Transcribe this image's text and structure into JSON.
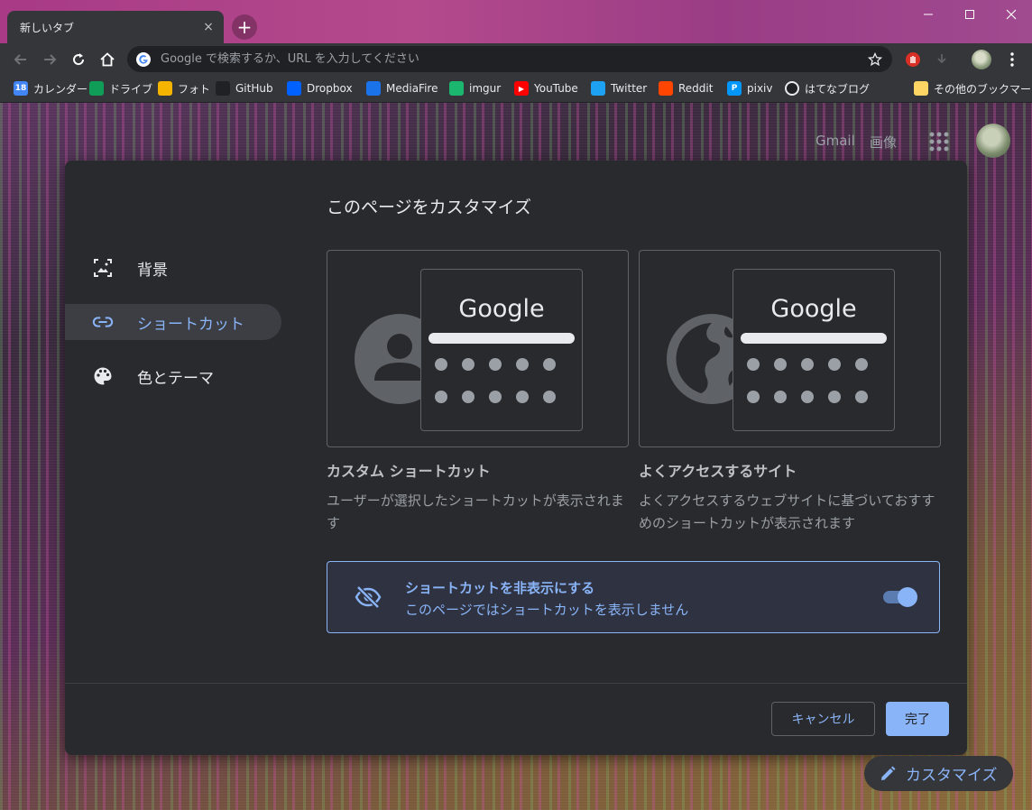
{
  "window": {
    "tab_title": "新しいタブ",
    "tab_close": "×",
    "new_tab": "+"
  },
  "toolbar": {
    "omnibox_placeholder": "Google で検索するか、URL を入力してください"
  },
  "bookmarks": [
    {
      "label": "カレンダー",
      "icon": "calendar-icon",
      "color": "#4285f4",
      "glyph": "18"
    },
    {
      "label": "ドライブ",
      "icon": "drive-icon",
      "color": "#0f9d58",
      "glyph": ""
    },
    {
      "label": "フォト",
      "icon": "photos-icon",
      "color": "#f4b400",
      "glyph": ""
    },
    {
      "label": "GitHub",
      "icon": "github-icon",
      "color": "#202124",
      "glyph": ""
    },
    {
      "label": "Dropbox",
      "icon": "dropbox-icon",
      "color": "#0061fe",
      "glyph": ""
    },
    {
      "label": "MediaFire",
      "icon": "mediafire-icon",
      "color": "#1a73e8",
      "glyph": ""
    },
    {
      "label": "imgur",
      "icon": "imgur-icon",
      "color": "#1bb76e",
      "glyph": ""
    },
    {
      "label": "YouTube",
      "icon": "youtube-icon",
      "color": "#ff0000",
      "glyph": "▶"
    },
    {
      "label": "Twitter",
      "icon": "twitter-icon",
      "color": "#1da1f2",
      "glyph": ""
    },
    {
      "label": "Reddit",
      "icon": "reddit-icon",
      "color": "#ff4500",
      "glyph": ""
    },
    {
      "label": "pixiv",
      "icon": "pixiv-icon",
      "color": "#0096fa",
      "glyph": "P"
    },
    {
      "label": "はてなブログ",
      "icon": "hatena-icon",
      "color": "#e8eaed",
      "glyph": ""
    },
    {
      "label": "その他のブックマーク",
      "icon": "folder-icon",
      "color": "#fdd663",
      "glyph": ""
    }
  ],
  "ntp": {
    "gmail": "Gmail",
    "images": "画像"
  },
  "dialog": {
    "title": "このページをカスタマイズ",
    "sidebar": [
      {
        "label": "背景",
        "icon": "image-icon"
      },
      {
        "label": "ショートカット",
        "icon": "link-icon"
      },
      {
        "label": "色とテーマ",
        "icon": "palette-icon"
      }
    ],
    "mini_google": "Google",
    "cards": [
      {
        "label": "カスタム ショートカット",
        "desc": "ユーザーが選択したショートカットが表示されます"
      },
      {
        "label": "よくアクセスするサイト",
        "desc": "よくアクセスするウェブサイトに基づいておすすめのショートカットが表示されます"
      }
    ],
    "hide": {
      "title": "ショートカットを非表示にする",
      "subtitle": "このページではショートカットを表示しません",
      "enabled": true
    },
    "cancel": "キャンセル",
    "done": "完了"
  },
  "customize_chip": "カスタマイズ",
  "colors": {
    "accent": "#8ab4f8",
    "dialog_bg": "#292a2d",
    "toolbar_bg": "#35363a"
  }
}
